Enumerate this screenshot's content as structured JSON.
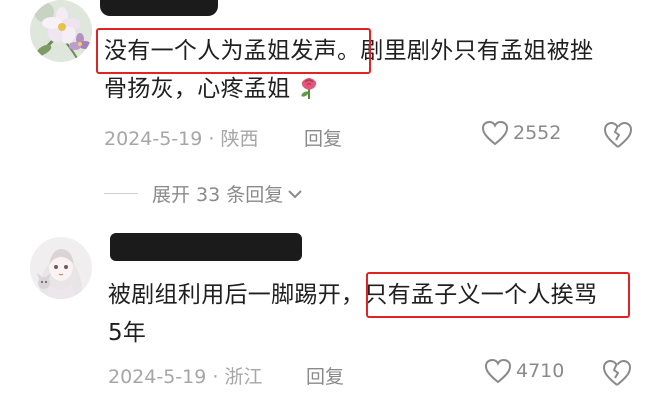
{
  "comments": [
    {
      "text_highlighted": "没有一个人为孟姐发声。",
      "text_rest_line1": "剧里剧外只有孟姐被挫",
      "text_line2": "骨扬灰，心疼孟姐",
      "date_location": "2024-5-19 · 陕西",
      "reply_label": "回复",
      "like_count": "2552",
      "avatar_icon": "flower-avatar-icon"
    },
    {
      "text_line1_start": "被剧组利用后一脚踢开，",
      "text_highlighted": "只有孟子义一个人挨骂",
      "text_line2": "5年",
      "date_location": "2024-5-19 · 浙江",
      "reply_label": "回复",
      "like_count": "4710",
      "avatar_icon": "anime-girl-avatar-icon"
    }
  ],
  "expand_replies": {
    "label": "展开 33 条回复"
  },
  "colors": {
    "highlight_box": "#e02424",
    "meta_text": "#a6a6a6",
    "body_text": "#1f1f1f"
  }
}
